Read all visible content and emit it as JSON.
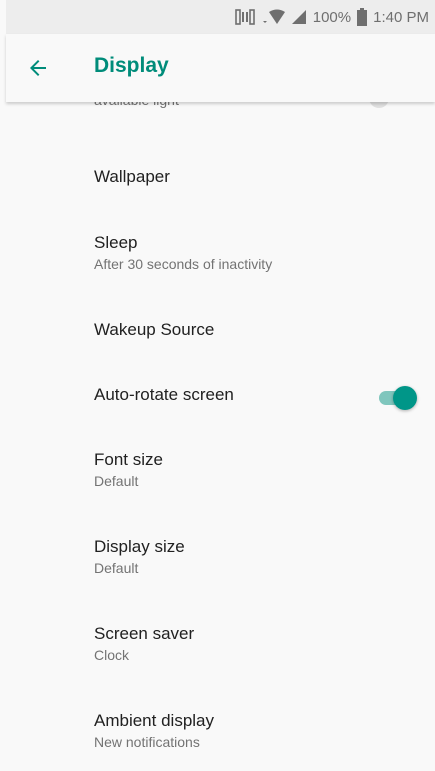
{
  "status_bar": {
    "battery_percent": "100%",
    "time": "1:40 PM"
  },
  "app_bar": {
    "title": "Display"
  },
  "partial_item": {
    "summary": "available light"
  },
  "items": [
    {
      "title": "Wallpaper",
      "summary": ""
    },
    {
      "title": "Sleep",
      "summary": "After 30 seconds of inactivity"
    },
    {
      "title": "Wakeup Source",
      "summary": ""
    },
    {
      "title": "Auto-rotate screen",
      "summary": "",
      "toggle_on": true
    },
    {
      "title": "Font size",
      "summary": "Default"
    },
    {
      "title": "Display size",
      "summary": "Default"
    },
    {
      "title": "Screen saver",
      "summary": "Clock"
    },
    {
      "title": "Ambient display",
      "summary": "New notifications"
    }
  ],
  "colors": {
    "accent": "#008c7a",
    "switch_thumb": "#009688",
    "switch_track": "#7fc6bd"
  }
}
